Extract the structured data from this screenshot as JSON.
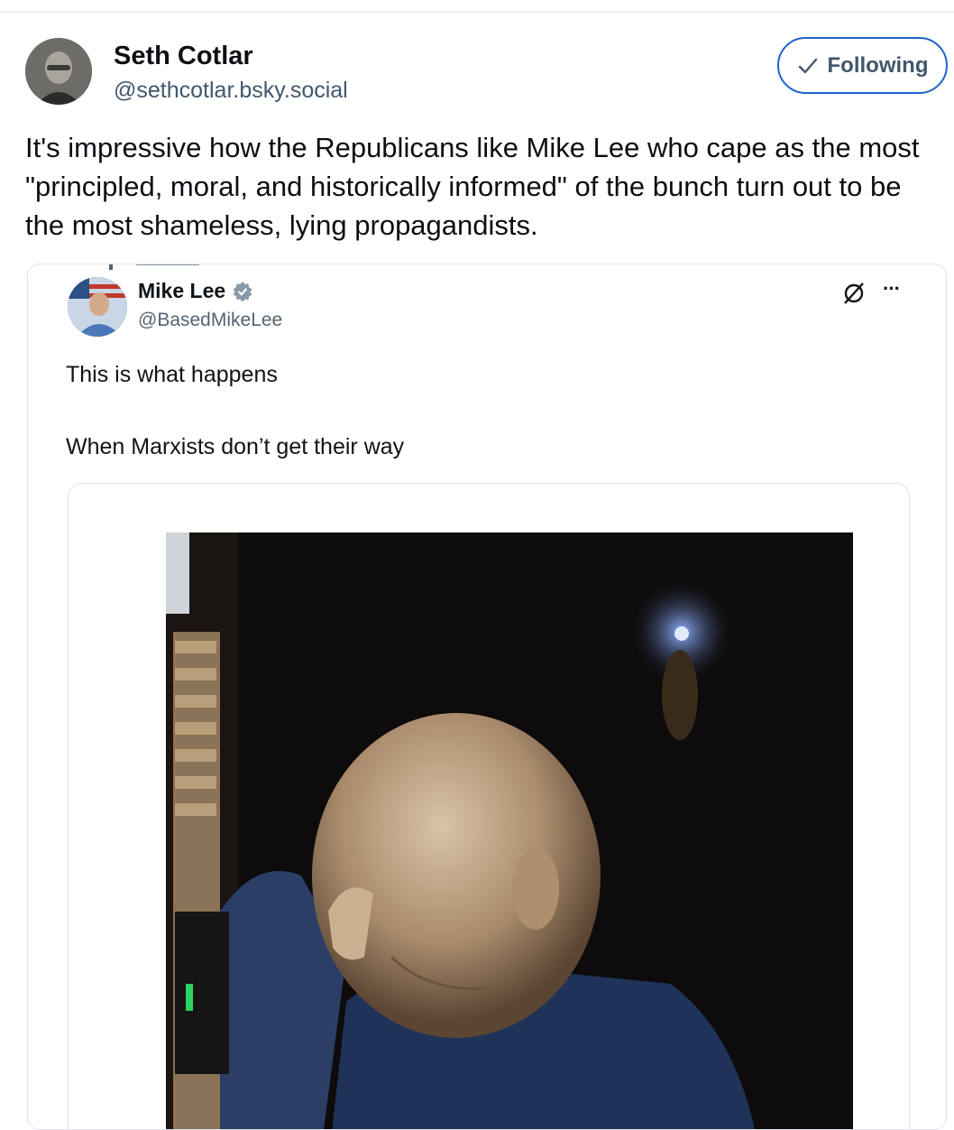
{
  "author": {
    "name": "Seth Cotlar",
    "handle": "@sethcotlar.bsky.social",
    "avatar_icon": "author-avatar-photo"
  },
  "follow_button": {
    "label": "Following",
    "icon": "checkmark-icon",
    "color": "#1f63c8"
  },
  "post": {
    "text": "It's impressive how the Republicans like Mike Lee who cape as the most \"principled, moral, and historically informed\" of the bunch turn out to be the most shameless, lying propagandists."
  },
  "quoted": {
    "name": "Mike Lee",
    "handle": "@BasedMikeLee",
    "verified_icon": "verified-badge-icon",
    "line1": "This is what happens",
    "line2": "When Marxists don’t get their way",
    "image_description_icon": "doorbell-camera-photo"
  }
}
